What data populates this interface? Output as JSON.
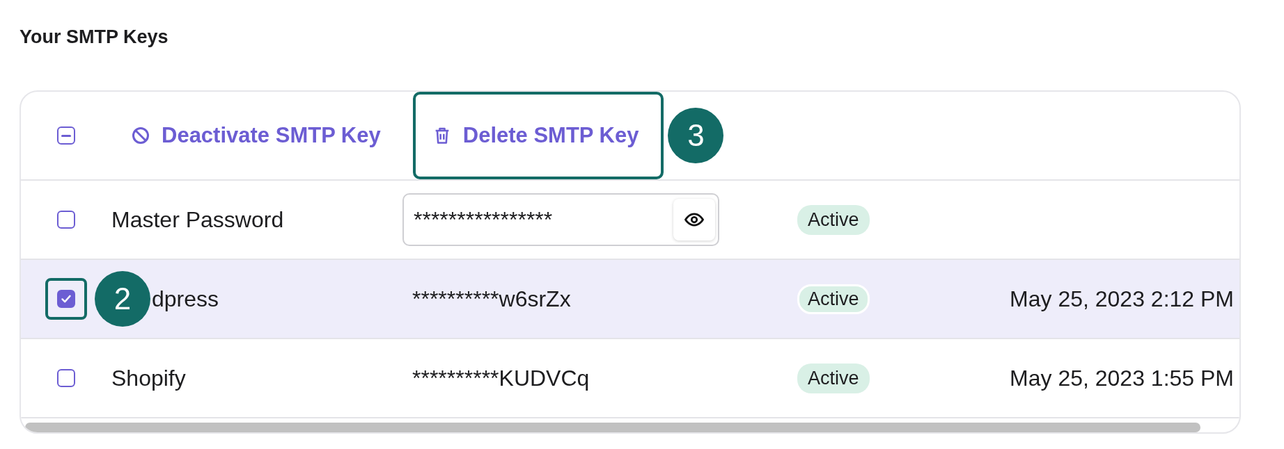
{
  "title": "Your SMTP Keys",
  "toolbar": {
    "select_all": {
      "indeterminate": true
    },
    "actions": [
      {
        "label": "Deactivate SMTP Key",
        "kind": "ban",
        "highlighted": false
      },
      {
        "label": "Delete SMTP Key",
        "kind": "trash",
        "highlighted": true,
        "callout": "3"
      }
    ]
  },
  "rows": [
    {
      "checked": false,
      "selected": false,
      "checkbox_highlighted": false,
      "name": "Master Password",
      "kind": "field",
      "key": "****************",
      "status": "Active"
    },
    {
      "checked": true,
      "selected": true,
      "checkbox_highlighted": true,
      "callout": "2",
      "name": "dpress",
      "kind": "text",
      "key": "**********w6srZx",
      "status": "Active",
      "date": "May 25, 2023 2:12 PM"
    },
    {
      "checked": false,
      "selected": false,
      "checkbox_highlighted": false,
      "name": "Shopify",
      "kind": "text",
      "key": "**********KUDVCq",
      "status": "Active",
      "date": "May 25, 2023 1:55 PM"
    }
  ]
}
